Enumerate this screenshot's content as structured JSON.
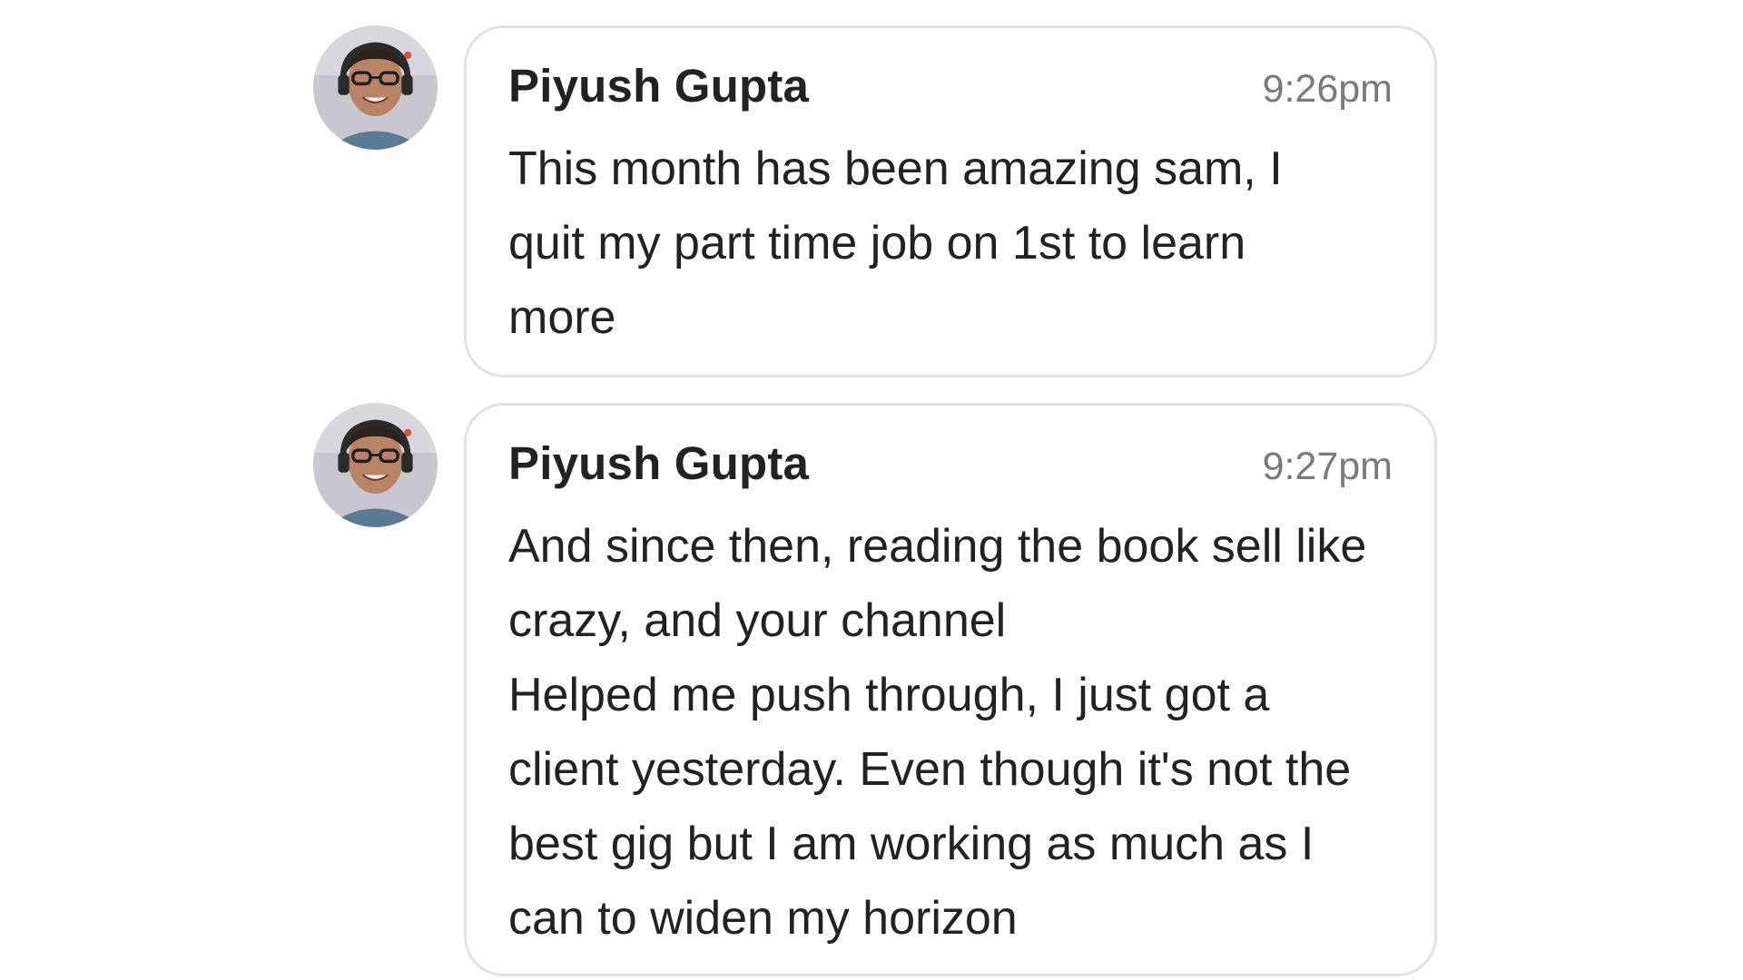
{
  "messages": [
    {
      "sender": "Piyush Gupta",
      "time": "9:26pm",
      "text": "This month has been amazing sam, I\nquit my part time job on 1st to learn\nmore"
    },
    {
      "sender": "Piyush Gupta",
      "time": "9:27pm",
      "text": "And since then, reading the book sell like\ncrazy, and your channel\nHelped me push through, I just got a\nclient yesterday. Even though it's not the\nbest gig but I am working as much as I\ncan to widen my horizon"
    }
  ],
  "colors": {
    "bubble_border": "#e2e2e2",
    "text": "#222222",
    "timestamp": "#7a7a7a"
  }
}
